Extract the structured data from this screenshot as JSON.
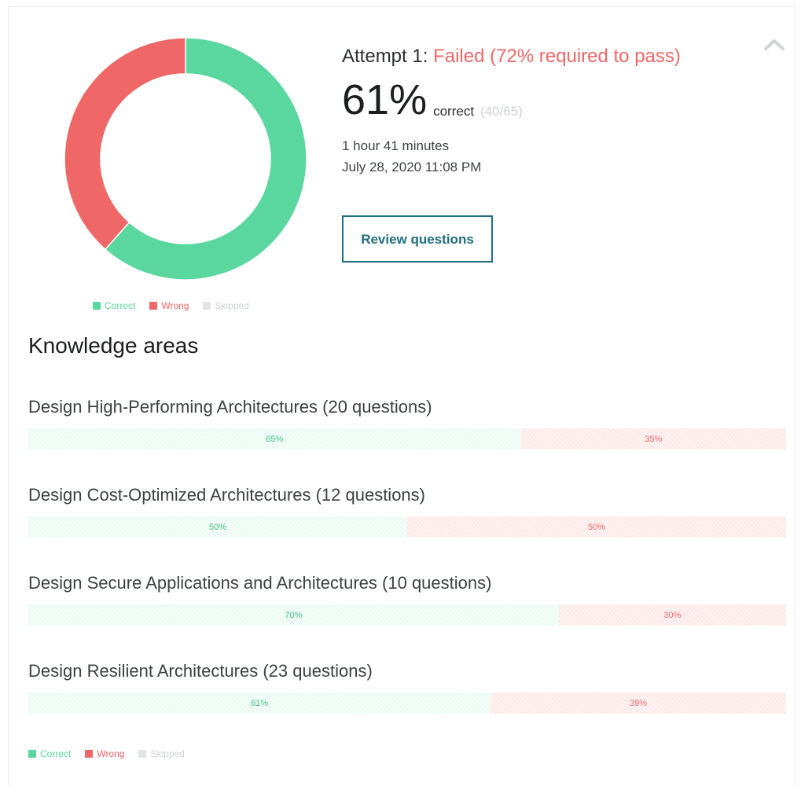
{
  "summary": {
    "attempt_label": "Attempt 1:",
    "status": "Failed (72% required to pass)",
    "score": "61%",
    "score_label": "correct",
    "score_count": "(40/65)",
    "duration": "1 hour 41 minutes",
    "date": "July 28, 2020 11:08 PM",
    "review_button": "Review questions"
  },
  "chart_data": {
    "type": "pie",
    "labels": [
      "Correct",
      "Wrong",
      "Skipped"
    ],
    "values": [
      40,
      25,
      0
    ],
    "colors": [
      "#5ad79f",
      "#ef6767",
      "#d1d3d5"
    ],
    "legend": "bottom"
  },
  "legend": {
    "correct": "Correct",
    "wrong": "Wrong",
    "skipped": "Skipped"
  },
  "knowledge": {
    "title": "Knowledge areas",
    "areas": [
      {
        "title": "Design High-Performing Architectures (20 questions)",
        "correct": 65,
        "wrong": 35,
        "correct_label": "65%",
        "wrong_label": "35%"
      },
      {
        "title": "Design Cost-Optimized Architectures (12 questions)",
        "correct": 50,
        "wrong": 50,
        "correct_label": "50%",
        "wrong_label": "50%"
      },
      {
        "title": "Design Secure Applications and Architectures (10 questions)",
        "correct": 70,
        "wrong": 30,
        "correct_label": "70%",
        "wrong_label": "30%"
      },
      {
        "title": "Design Resilient Architectures (23 questions)",
        "correct": 61,
        "wrong": 39,
        "correct_label": "61%",
        "wrong_label": "39%"
      }
    ]
  },
  "icons": {
    "collapse": "chevron-up-icon"
  }
}
